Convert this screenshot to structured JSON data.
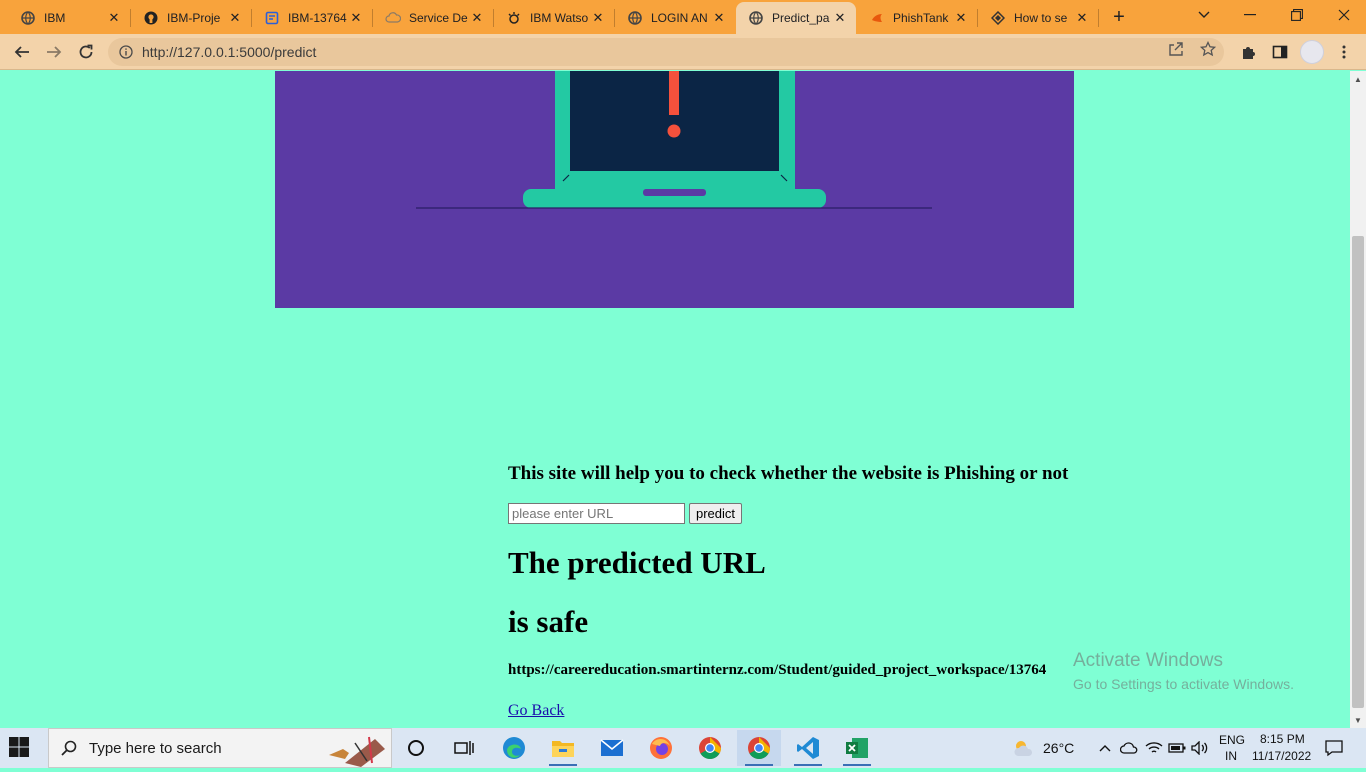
{
  "browser": {
    "tabs": [
      {
        "title": "IBM",
        "icon": "globe-icon"
      },
      {
        "title": "IBM-Proje",
        "icon": "github-icon"
      },
      {
        "title": "IBM-13764",
        "icon": "document-icon"
      },
      {
        "title": "Service De",
        "icon": "cloud-icon"
      },
      {
        "title": "IBM Watso",
        "icon": "watson-icon"
      },
      {
        "title": "LOGIN AN",
        "icon": "globe-icon"
      },
      {
        "title": "Predict_pa",
        "icon": "globe-icon"
      },
      {
        "title": "PhishTank",
        "icon": "phishtank-icon"
      },
      {
        "title": "How to se",
        "icon": "diamond-icon"
      }
    ],
    "active_tab_index": 6,
    "address": "http://127.0.0.1:5000/predict"
  },
  "page": {
    "lead_text": "This site will help you to check whether the website is Phishing or not",
    "url_input": {
      "placeholder": "please enter URL",
      "value": ""
    },
    "predict_button": "predict",
    "result_heading_1": "The predicted URL",
    "result_heading_2": "is safe",
    "checked_url": "https://careereducation.smartinternz.com/Student/guided_project_workspace/13764",
    "back_link": "Go Back",
    "colors": {
      "background": "#7fffd4",
      "hero": "#5b3aa4",
      "alert": "#f4513c",
      "laptop": "#23c9a3",
      "screen": "#0b2545"
    }
  },
  "watermark": {
    "line1": "Activate Windows",
    "line2": "Go to Settings to activate Windows."
  },
  "taskbar": {
    "search_placeholder": "Type here to search",
    "weather": "26°C",
    "language_1": "ENG",
    "language_2": "IN",
    "time": "8:15 PM",
    "date": "11/17/2022",
    "apps": [
      "cortana-icon",
      "task-view-icon",
      "edge-icon",
      "file-explorer-icon",
      "mail-icon",
      "firefox-icon",
      "chrome-icon",
      "chrome-icon",
      "vscode-icon",
      "excel-icon"
    ]
  }
}
